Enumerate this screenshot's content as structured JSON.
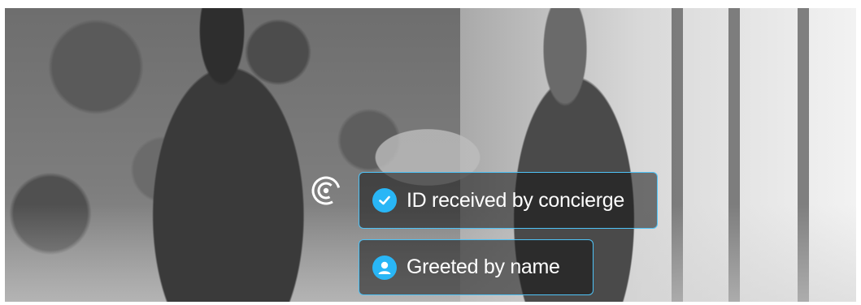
{
  "overlay": {
    "cards": [
      {
        "label": "ID received by concierge",
        "icon": "check-circle-icon"
      },
      {
        "label": "Greeted by name",
        "icon": "user-circle-icon"
      }
    ],
    "indicator_icon": "tap-radar-icon",
    "accent_color": "#29b6f6",
    "border_color": "#4fc3f7"
  }
}
